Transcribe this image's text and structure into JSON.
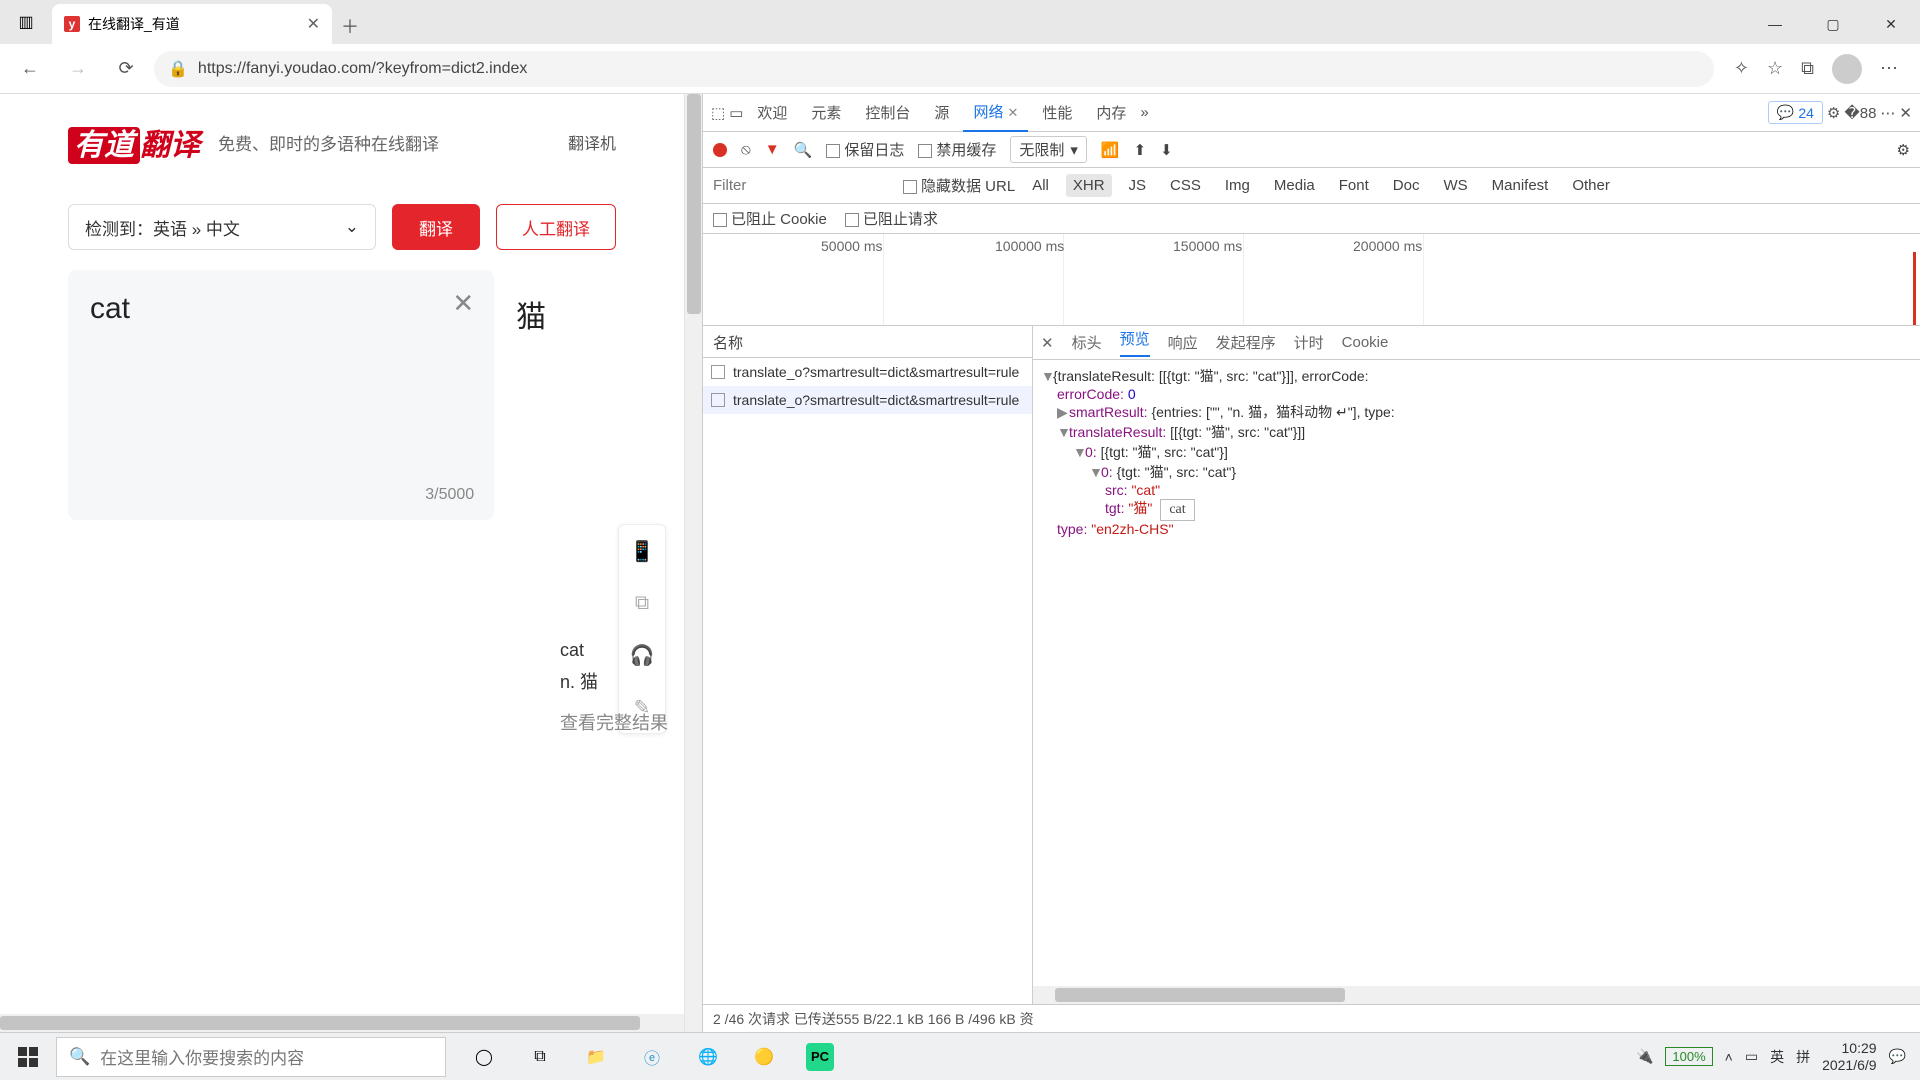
{
  "browser": {
    "tab_title": "在线翻译_有道",
    "url": "https://fanyi.youdao.com/?keyfrom=dict2.index",
    "favicon_letter": "y"
  },
  "page": {
    "logo_main": "有道",
    "logo_sub": "翻译",
    "tagline": "免费、即时的多语种在线翻译",
    "nav_link": "翻译机",
    "lang_detect": "检测到：英语 » 中文",
    "btn_translate": "翻译",
    "btn_human": "人工翻译",
    "input_text": "cat",
    "char_count": "3/5000",
    "output_text": "猫",
    "smart_word": "cat",
    "smart_def": "n. 猫",
    "view_full": "查看完整结果"
  },
  "devtools": {
    "tabs": {
      "welcome": "欢迎",
      "elements": "元素",
      "console": "控制台",
      "sources": "源",
      "network": "网络",
      "performance": "性能",
      "memory": "内存"
    },
    "badge_count": "24",
    "toolbar": {
      "preserve": "保留日志",
      "disable_cache": "禁用缓存",
      "throttle": "无限制"
    },
    "filter_placeholder": "Filter",
    "filter_labels": {
      "hide": "隐藏数据 URL",
      "all": "All",
      "xhr": "XHR",
      "js": "JS",
      "css": "CSS",
      "img": "Img",
      "media": "Media",
      "font": "Font",
      "doc": "Doc",
      "ws": "WS",
      "manifest": "Manifest",
      "other": "Other"
    },
    "block_labels": {
      "cookie": "已阻止 Cookie",
      "req": "已阻止请求"
    },
    "ticks": [
      "50000 ms",
      "100000 ms",
      "150000 ms",
      "200000 ms"
    ],
    "reqlist_header": "名称",
    "request_name": "translate_o?smartresult=dict&smartresult=rule",
    "detail_tabs": {
      "headers": "标头",
      "preview": "预览",
      "response": "响应",
      "initiator": "发起程序",
      "timing": "计时",
      "cookies": "Cookie"
    },
    "preview": {
      "root": "{translateResult: [[{tgt: \"猫\", src: \"cat\"}]], errorCode:",
      "errorCode_k": "errorCode:",
      "errorCode_v": "0",
      "smart_k": "smartResult:",
      "smart_v": "{entries: [\"\", \"n. 猫，猫科动物 ↵\"], type:",
      "tr_k": "translateResult:",
      "tr_v": "[[{tgt: \"猫\", src: \"cat\"}]]",
      "idx0_k": "0:",
      "idx0_v": "[{tgt: \"猫\", src: \"cat\"}]",
      "idx00_k": "0:",
      "idx00_v": "{tgt: \"猫\", src: \"cat\"}",
      "src_k": "src:",
      "src_v": "\"cat\"",
      "tgt_k": "tgt:",
      "tgt_v": "\"猫\"",
      "type_k": "type:",
      "type_v": "\"en2zh-CHS\"",
      "tooltip": "cat"
    },
    "status": "2 /46 次请求  已传送555 B/22.1 kB  166 B /496 kB 资"
  },
  "taskbar": {
    "search_placeholder": "在这里输入你要搜索的内容",
    "battery": "100%",
    "ime1": "英",
    "ime2": "拼",
    "time": "10:29",
    "date": "2021/6/9"
  }
}
